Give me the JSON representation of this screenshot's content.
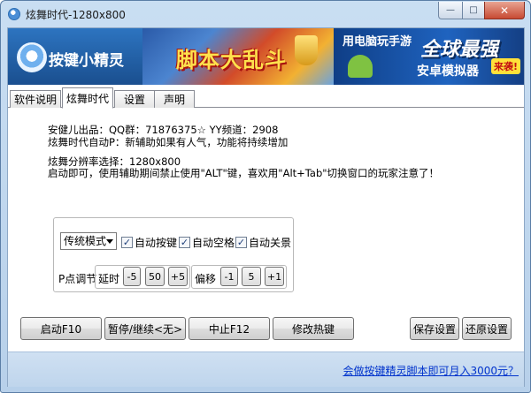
{
  "window": {
    "title": "炫舞时代-1280x800",
    "minimize_glyph": "—",
    "maximize_glyph": "□",
    "close_glyph": "✕"
  },
  "banner": {
    "logo_text": "按键小精灵",
    "ad1_text": "脚本大乱斗",
    "ad2_top": "用电脑玩手游",
    "ad2_big": "全球最强",
    "ad2_sub": "安卓模拟器",
    "ad2_badge": "来袭!"
  },
  "tabs": [
    {
      "label": "软件说明",
      "active": false
    },
    {
      "label": "炫舞时代",
      "active": true
    },
    {
      "label": "设置",
      "active": false
    },
    {
      "label": "声明",
      "active": false
    }
  ],
  "info_lines": [
    "安健儿出品：QQ群：71876375☆ YY频道：2908",
    "炫舞时代自动P：新辅助如果有人气，功能将持续增加",
    "炫舞分辨率选择：1280x800",
    "启动即可，使用辅助期间禁止使用\"ALT\"键，喜欢用\"Alt+Tab\"切换窗口的玩家注意了！"
  ],
  "controls": {
    "mode_select": "传统模式",
    "checkboxes": [
      {
        "label": "自动按键",
        "checked": true
      },
      {
        "label": "自动空格",
        "checked": true
      },
      {
        "label": "自动关景",
        "checked": true
      }
    ],
    "p_label": "P点调节",
    "delay": {
      "label": "延时",
      "minus": "-5",
      "value": "50",
      "plus": "+5"
    },
    "offset": {
      "label": "偏移",
      "minus": "-1",
      "value": "5",
      "plus": "+1"
    }
  },
  "buttons": {
    "start": "启动F10",
    "pause": "暂停/继续<无>",
    "stop": "中止F12",
    "hotkey": "修改热键",
    "save": "保存设置",
    "restore": "还原设置"
  },
  "footer": {
    "link": "会做按键精灵脚本即可月入3000元？"
  }
}
